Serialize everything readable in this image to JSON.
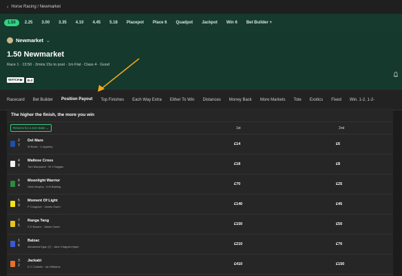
{
  "breadcrumb": {
    "text": "Horse Racing / Newmarket"
  },
  "times": [
    "1.50",
    "2.25",
    "3.00",
    "3.35",
    "4.10",
    "4.45",
    "5.18",
    "Placepot",
    "Place 6",
    "Quadpot",
    "Jackpot",
    "Win 6",
    "Bet Builder +"
  ],
  "header": {
    "venue": "Newmarket",
    "race_title": "1.50 Newmarket",
    "race_info": "Race 1 · 13:50 · 2mins 15s to post · 1m Flat · Class 4 · Good",
    "watch_label": "WATCH ▶",
    "dd_label": "Ð.d"
  },
  "tabs": [
    "Racecard",
    "Bet Builder",
    "Position Payout",
    "Top Finishes",
    "Each Way Extra",
    "Either To Win",
    "Distances",
    "Money Back",
    "More Markets",
    "Tote",
    "Exotics",
    "Fixed",
    "Win. 1-2, 1-2-"
  ],
  "payout": {
    "heading": "The higher the finish, the more you win",
    "returns_label": "Returns for a £10 stake ⌄",
    "col_1st": "1st",
    "col_2nd": "2nd"
  },
  "runners": [
    {
      "num": "2",
      "draw": "7",
      "horse": "Del Mare",
      "people": "W Buick · C Appleby",
      "p1": "£14",
      "p2": "£6",
      "silk": "#1f4fa8"
    },
    {
      "num": "4",
      "draw": "8",
      "horse": "Maltese Cross",
      "people": "Tom Marquand · W J Haggas",
      "p1": "£18",
      "p2": "£8",
      "silk": "#f2f2f2"
    },
    {
      "num": "6",
      "draw": "4",
      "horse": "Moonlight Warrior",
      "people": "Oisin Murphy · A M Balding",
      "p1": "£70",
      "p2": "£25",
      "silk": "#2c8a3e"
    },
    {
      "num": "5",
      "draw": "9",
      "horse": "Moment Of Light",
      "people": "P Cosgrave · James Owen",
      "p1": "£140",
      "p2": "£45",
      "silk": "#f5e21b"
    },
    {
      "num": "7",
      "draw": "5",
      "horse": "Ranga Tang",
      "people": "S D Bowen · James Owen",
      "p1": "£150",
      "p2": "£50",
      "silk": "#e8c31a"
    },
    {
      "num": "1",
      "draw": "6",
      "horse": "Balzac",
      "people": "Alexandra Egan (7) · Jane Chapple-Hyam",
      "p1": "£210",
      "p2": "£70",
      "silk": "#3b5bd1"
    },
    {
      "num": "3",
      "draw": "2",
      "horse": "Jackabi",
      "people": "D C Costello · Ian Williams",
      "p1": "£410",
      "p2": "£150",
      "silk": "#e9702a"
    }
  ],
  "colors": {
    "accent": "#2fd580",
    "header_bg": "#153a2d",
    "arrow": "#f2a81d"
  }
}
